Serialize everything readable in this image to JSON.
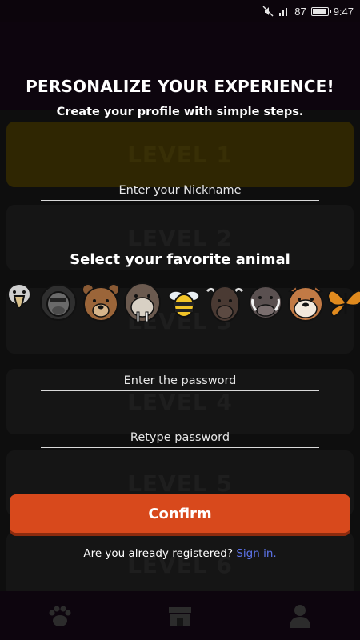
{
  "status_bar": {
    "battery_percent": "87",
    "time": "9:47"
  },
  "header": {
    "title": "PERSONALIZE YOUR EXPERIENCE!",
    "subtitle": "Create your profile with simple steps."
  },
  "form": {
    "nickname_placeholder": "Enter your Nickname",
    "animal_heading": "Select your favorite animal",
    "password_placeholder": "Enter the password",
    "retype_placeholder": "Retype password"
  },
  "animals": [
    "shoebill",
    "gorilla",
    "bear",
    "walrus",
    "bee",
    "bison",
    "warthog",
    "bulldog",
    "monarch-butterfly"
  ],
  "confirm_label": "Confirm",
  "signin": {
    "question": "Are you already registered?",
    "link": "Sign in."
  },
  "background": {
    "levels": [
      "LEVEL 1",
      "LEVEL 2",
      "LEVEL 3",
      "LEVEL 4",
      "LEVEL 5",
      "LEVEL 6"
    ],
    "nav": [
      "paw-icon",
      "store-icon",
      "profile-icon"
    ]
  },
  "colors": {
    "accent": "#d8491c",
    "link": "#5d73e8"
  }
}
